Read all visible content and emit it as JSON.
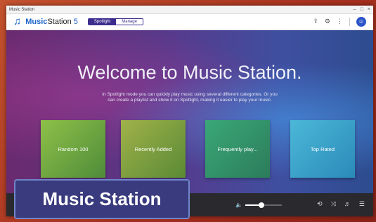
{
  "window": {
    "title": "Music Station",
    "controls": [
      "–",
      "□",
      "×"
    ]
  },
  "appbar": {
    "logo_icon": "music-note-icon",
    "app_name_bold": "Music",
    "app_name_rest": "Station",
    "app_version": "5",
    "modes": [
      "Spotlight",
      "Manage"
    ],
    "active_mode": "Spotlight",
    "tools": [
      "upload-icon",
      "settings-icon",
      "more-icon"
    ],
    "avatar_label": "☺"
  },
  "hero": {
    "title": "Welcome to Music Station.",
    "description": "In Spotlight mode you can quickly play music using several different categories. Or you can create a playlist and show it on Spotlight, making it easier to play your music."
  },
  "cards": [
    {
      "label": "Random 100"
    },
    {
      "label": "Recently Added"
    },
    {
      "label": "Frequently play..."
    },
    {
      "label": "Top Rated"
    }
  ],
  "player": {
    "volume_fraction": 0.45,
    "icons": [
      "repeat-icon",
      "shuffle-icon",
      "equalizer-icon",
      "playlist-icon"
    ]
  },
  "badge": {
    "text": "Music Station"
  },
  "colors": {
    "frame": "#b7402e",
    "accent": "#1f66c9",
    "mode_active": "#3c2c8e",
    "player_bg": "#2a2a2e",
    "badge_bg": "#3a3a7e"
  }
}
